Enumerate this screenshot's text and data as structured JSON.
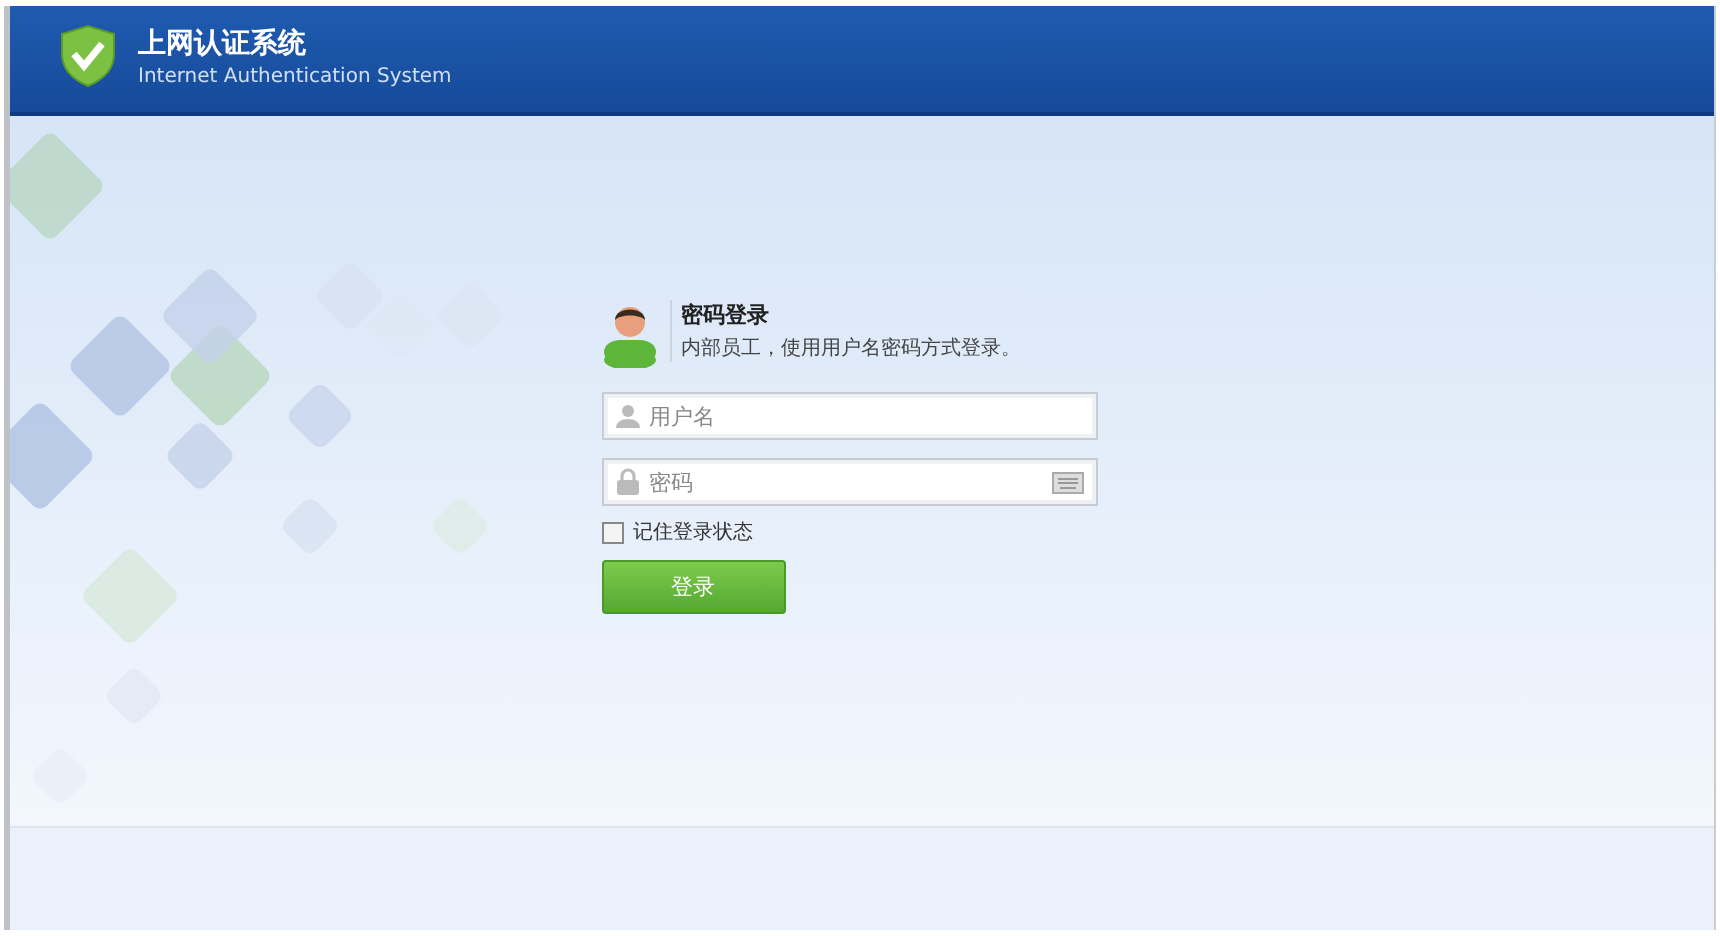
{
  "header": {
    "title": "上网认证系统",
    "subtitle": "Internet Authentication System"
  },
  "login": {
    "title": "密码登录",
    "description": "内部员工，使用用户名密码方式登录。",
    "username": {
      "placeholder": "用户名"
    },
    "password": {
      "placeholder": "密码"
    },
    "remember": {
      "label": "记住登录状态",
      "checked": false
    },
    "submit": "登录"
  }
}
